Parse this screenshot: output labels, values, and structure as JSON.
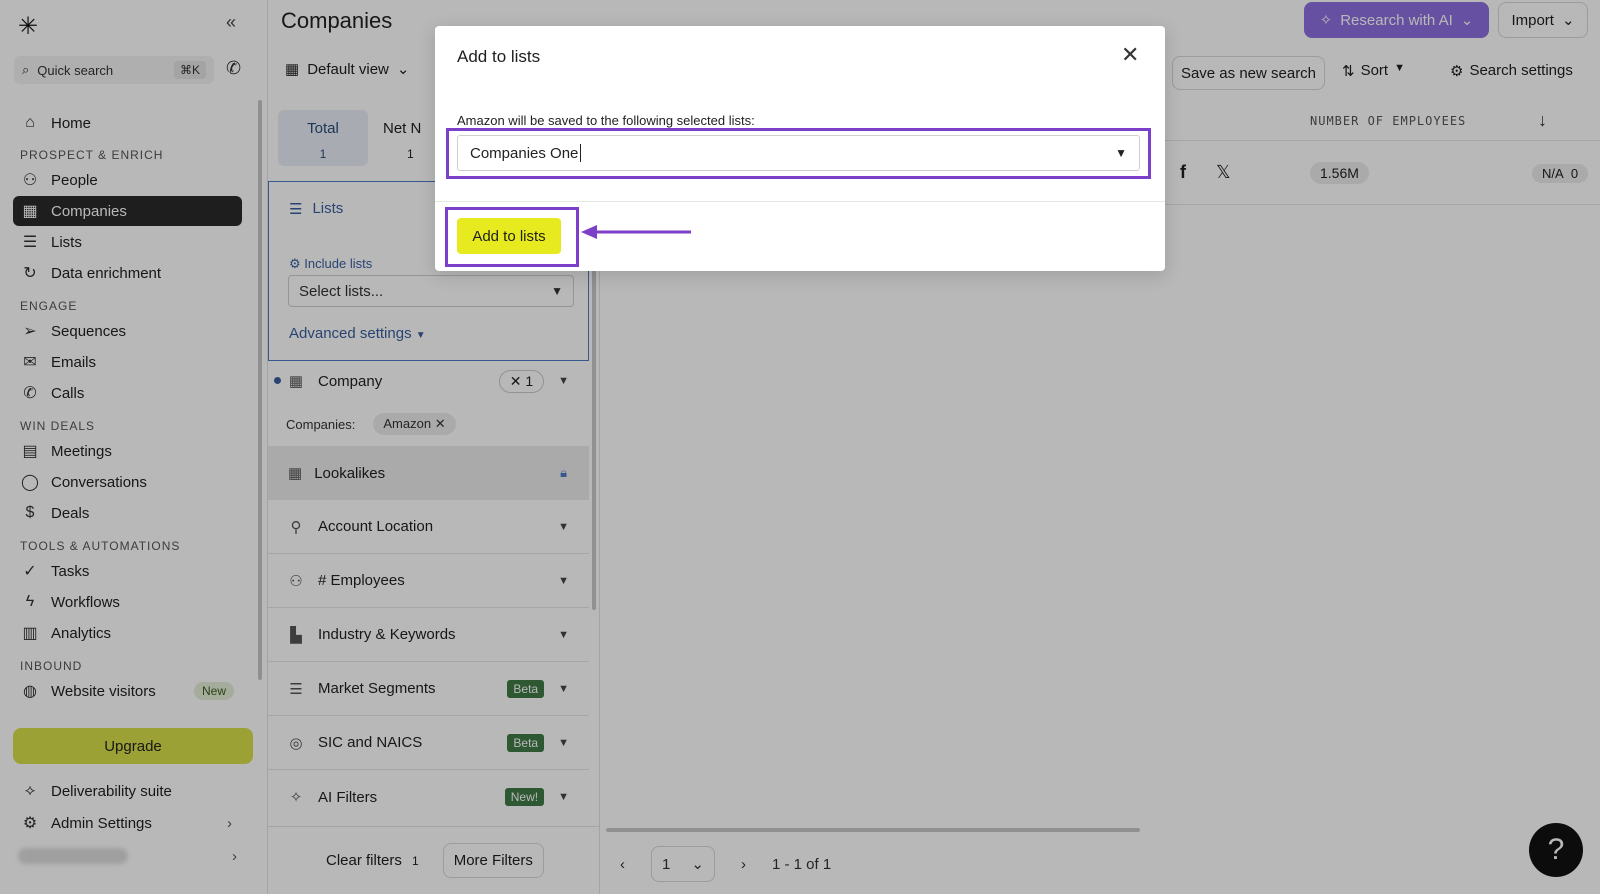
{
  "app": {
    "page_title": "Companies",
    "collapse_icon": "«",
    "logo_icon": "✳"
  },
  "sidebar": {
    "quick_search": "Quick search",
    "shortcut": "⌘K",
    "sections": {
      "prospect": "PROSPECT & ENRICH",
      "engage": "ENGAGE",
      "win": "WIN DEALS",
      "tools": "TOOLS & AUTOMATIONS",
      "inbound": "INBOUND"
    },
    "items": {
      "home": "Home",
      "people": "People",
      "companies": "Companies",
      "lists": "Lists",
      "data_enrichment": "Data enrichment",
      "sequences": "Sequences",
      "emails": "Emails",
      "calls": "Calls",
      "meetings": "Meetings",
      "conversations": "Conversations",
      "deals": "Deals",
      "tasks": "Tasks",
      "workflows": "Workflows",
      "analytics": "Analytics",
      "website_visitors": "Website visitors",
      "deliverability": "Deliverability suite",
      "admin": "Admin Settings"
    },
    "new_badge": "New",
    "upgrade": "Upgrade"
  },
  "header": {
    "research_ai": "Research with AI",
    "import": "Import",
    "default_view": "Default view",
    "save_search": "Save as new search",
    "sort": "Sort",
    "search_settings": "Search settings"
  },
  "filters": {
    "tab_total": "Total",
    "tab_total_count": "1",
    "tab_net": "Net N",
    "tab_net_count": "1",
    "lists_title": "Lists",
    "include_lists": "Include lists",
    "select_placeholder": "Select lists...",
    "advanced": "Advanced settings",
    "company": "Company",
    "company_count": "1",
    "companies_label": "Companies:",
    "company_tag": "Amazon",
    "lookalikes": "Lookalikes",
    "account_location": "Account Location",
    "employees": "# Employees",
    "industry": "Industry & Keywords",
    "market_segments": "Market Segments",
    "sic_naics": "SIC and NAICS",
    "ai_filters": "AI Filters",
    "beta": "Beta",
    "new_tag": "New!",
    "clear_filters": "Clear filters",
    "clear_count": "1",
    "more_filters": "More Filters"
  },
  "table": {
    "column_header": "NUMBER OF EMPLOYEES",
    "employees_value": "1.56M",
    "na_value": "N/A",
    "na_count": "0"
  },
  "pagination": {
    "page": "1",
    "range": "1 - 1 of 1"
  },
  "help": "?",
  "modal": {
    "title": "Add to lists",
    "label": "Amazon will be saved to the following selected lists:",
    "selected_list": "Companies One",
    "add_button": "Add to lists"
  },
  "colors": {
    "highlight": "#7b3fc9",
    "add_button": "#e6ea1e",
    "upgrade": "#d9e04a",
    "ai_button": "#8d6fe0"
  }
}
